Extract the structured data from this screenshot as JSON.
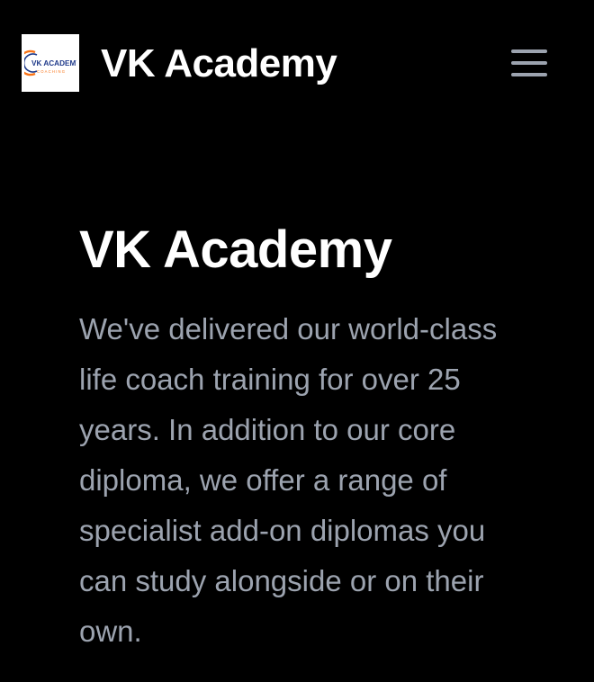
{
  "header": {
    "logo": {
      "icon": "vk-academy-logo-icon",
      "text_line1": "VK ACADEMY",
      "text_line2": "COACHING",
      "colors": {
        "primary": "#1f3a8a",
        "accent": "#f97316"
      }
    },
    "brand_name": "VK Academy",
    "menu_icon": "hamburger-menu-icon"
  },
  "hero": {
    "title": "VK Academy",
    "description": "We've delivered our world-class life coach training for over 25 years. In addition to our core diploma, we offer a range of specialist add-on diplomas you can study alongside or on their own."
  },
  "colors": {
    "background": "#000000",
    "heading": "#ffffff",
    "body_text": "#9ca3af",
    "menu_icon": "#9ca3af"
  }
}
